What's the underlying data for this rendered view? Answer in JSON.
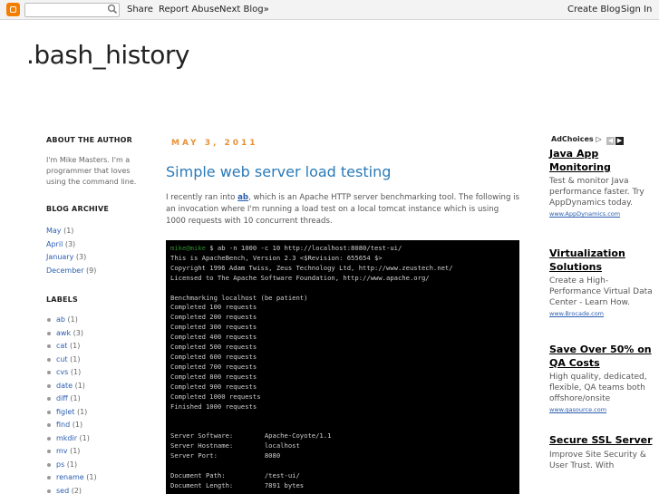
{
  "navbar": {
    "share": "Share",
    "report_abuse": "Report Abuse",
    "next_blog": "Next Blog»",
    "create_blog": "Create Blog",
    "sign_in": "Sign In",
    "search_value": ""
  },
  "blog": {
    "title": ".bash_history"
  },
  "sidebar": {
    "about_title": "About the Author",
    "about_text": "I'm Mike Masters. I'm a programmer that loves using the command line.",
    "archive_title": "Blog Archive",
    "archive": [
      {
        "label": "May",
        "count": " (1)"
      },
      {
        "label": "April",
        "count": " (3)"
      },
      {
        "label": "January",
        "count": " (3)"
      },
      {
        "label": "December",
        "count": " (9)"
      }
    ],
    "labels_title": "Labels",
    "labels": [
      {
        "label": "ab",
        "count": " (1)"
      },
      {
        "label": "awk",
        "count": " (3)"
      },
      {
        "label": "cat",
        "count": " (1)"
      },
      {
        "label": "cut",
        "count": " (1)"
      },
      {
        "label": "cvs",
        "count": " (1)"
      },
      {
        "label": "date",
        "count": " (1)"
      },
      {
        "label": "diff",
        "count": " (1)"
      },
      {
        "label": "figlet",
        "count": " (1)"
      },
      {
        "label": "find",
        "count": " (1)"
      },
      {
        "label": "mkdir",
        "count": " (1)"
      },
      {
        "label": "mv",
        "count": " (1)"
      },
      {
        "label": "ps",
        "count": " (1)"
      },
      {
        "label": "rename",
        "count": " (1)"
      },
      {
        "label": "sed",
        "count": " (2)"
      }
    ]
  },
  "post": {
    "date": "May 3, 2011",
    "title": "Simple web server load testing",
    "intro_before": "I recently ran into ",
    "intro_link": "ab",
    "intro_after": ", which is an Apache HTTP server benchmarking tool. The following is an invocation where I'm running a load test on a local tomcat instance which is using 1000 requests with 10 concurrent threads.",
    "terminal_prompt": "mike@mike",
    "terminal_first": " $ ab -n 1000 -c 10 http://localhost:8080/test-ui/",
    "terminal_rest": "This is ApacheBench, Version 2.3 <$Revision: 655654 $>\nCopyright 1996 Adam Twiss, Zeus Technology Ltd, http://www.zeustech.net/\nLicensed to The Apache Software Foundation, http://www.apache.org/\n\nBenchmarking localhost (be patient)\nCompleted 100 requests\nCompleted 200 requests\nCompleted 300 requests\nCompleted 400 requests\nCompleted 500 requests\nCompleted 600 requests\nCompleted 700 requests\nCompleted 800 requests\nCompleted 900 requests\nCompleted 1000 requests\nFinished 1000 requests\n\n\nServer Software:        Apache-Coyote/1.1\nServer Hostname:        localhost\nServer Port:            8080\n\nDocument Path:          /test-ui/\nDocument Length:        7891 bytes"
  },
  "ads": {
    "adchoices": "AdChoices ▷",
    "items": [
      {
        "title": "Java App Monitoring",
        "body": "Test & monitor Java performance faster. Try AppDynamics today.",
        "url": "www.AppDynamics.com"
      },
      {
        "title": "Virtualization Solutions",
        "body": "Create a High-Performance Virtual Data Center - Learn How.",
        "url": "www.Brocade.com"
      },
      {
        "title": "Save Over 50% on QA Costs",
        "body": "High quality, dedicated, flexible, QA teams both offshore/onsite",
        "url": "www.qasource.com"
      },
      {
        "title": "Secure SSL Server",
        "body": "Improve Site Security & User Trust. With",
        "url": ""
      }
    ]
  }
}
